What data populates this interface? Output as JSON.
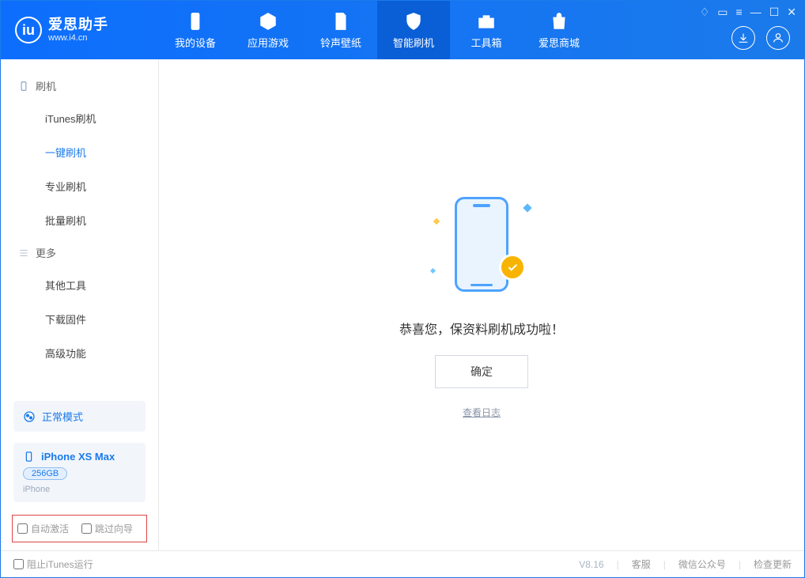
{
  "app": {
    "name_cn": "爱思助手",
    "name_en": "www.i4.cn"
  },
  "tabs": [
    {
      "label": "我的设备"
    },
    {
      "label": "应用游戏"
    },
    {
      "label": "铃声壁纸"
    },
    {
      "label": "智能刷机"
    },
    {
      "label": "工具箱"
    },
    {
      "label": "爱思商城"
    }
  ],
  "sidebar": {
    "group1_title": "刷机",
    "group1": [
      {
        "label": "iTunes刷机"
      },
      {
        "label": "一键刷机"
      },
      {
        "label": "专业刷机"
      },
      {
        "label": "批量刷机"
      }
    ],
    "group2_title": "更多",
    "group2": [
      {
        "label": "其他工具"
      },
      {
        "label": "下载固件"
      },
      {
        "label": "高级功能"
      }
    ],
    "mode_label": "正常模式",
    "device": {
      "name": "iPhone XS Max",
      "storage": "256GB",
      "type": "iPhone"
    },
    "checkbox1": "自动激活",
    "checkbox2": "跳过向导"
  },
  "main": {
    "success_text": "恭喜您，保资料刷机成功啦！",
    "ok_button": "确定",
    "log_link": "查看日志"
  },
  "footer": {
    "prevent_itunes": "阻止iTunes运行",
    "version": "V8.16",
    "links": [
      "客服",
      "微信公众号",
      "检查更新"
    ]
  }
}
